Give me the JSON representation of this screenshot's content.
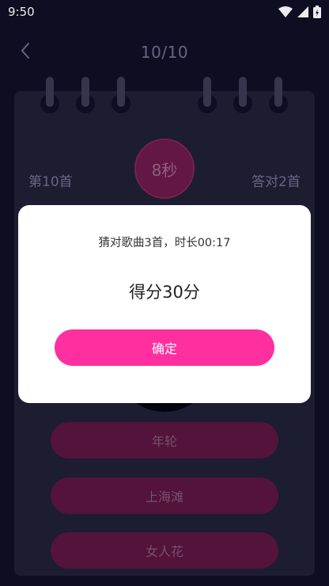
{
  "status_bar": {
    "time": "9:50",
    "icons": [
      "wifi-icon",
      "signal-icon",
      "battery-icon"
    ]
  },
  "header": {
    "back_icon": "chevron-left-icon",
    "progress": "10/10"
  },
  "game": {
    "song_index": "第10首",
    "timer": "8秒",
    "correct_count": "答对2首",
    "options": [
      {
        "label": "年轮"
      },
      {
        "label": "上海滩"
      },
      {
        "label": "女人花"
      }
    ]
  },
  "dialog": {
    "summary": "猜对歌曲3首，时长00:17",
    "score": "得分30分",
    "confirm_label": "确定"
  },
  "colors": {
    "background": "#0f1024",
    "card": "#1f2036",
    "accent": "#ff2fa0",
    "option": "#5b1540"
  }
}
